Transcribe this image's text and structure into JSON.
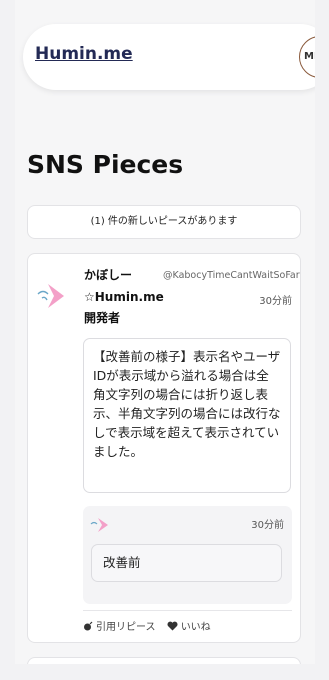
{
  "header": {
    "brand": "Humin.me",
    "menu_label": "MENU"
  },
  "page_title": "SNS Pieces",
  "notice": "(1) 件の新しいピースがあります",
  "post": {
    "author_name": "かぼしー",
    "author_handle": "@KabocyTimeCantWaitSoFar",
    "author_affiliation": "☆Humin.me",
    "author_role": "開発者",
    "time": "30分前",
    "body": "【改善前の様子】表示名やユーザIDが表示域から溢れる場合は全角文字列の場合には折り返し表示、半角文字列の場合には改行なしで表示域を超えて表示されていました。",
    "quote": {
      "time": "30分前",
      "body": "改善前"
    },
    "actions": {
      "quote_repiece": "引用リピース",
      "like": "いいね"
    }
  },
  "colors": {
    "brand": "#232a55",
    "avatar_accent": "#f3a0c8"
  }
}
